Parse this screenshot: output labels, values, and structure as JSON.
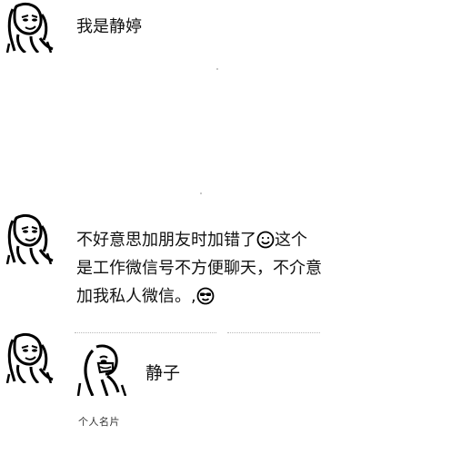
{
  "chat": {
    "messages": [
      {
        "text": "我是静婷"
      },
      {
        "line1_a": "不好意思加朋友时加错了",
        "line1_b": "这个",
        "line2": "是工作微信号不方便聊天，不介意",
        "line3": "加我私人微信。,",
        "emoji_1": "smile-emoji-icon",
        "emoji_2": "sunglasses-emoji-icon"
      }
    ],
    "contact_card": {
      "name": "静子",
      "footer_label": "个人名片",
      "avatar_icon": "contact-avatar-icon"
    }
  },
  "avatar_icon": "user-avatar-icon",
  "colors": {
    "background": "#ffffff",
    "text": "#111111",
    "divider": "#b8b8b8"
  }
}
